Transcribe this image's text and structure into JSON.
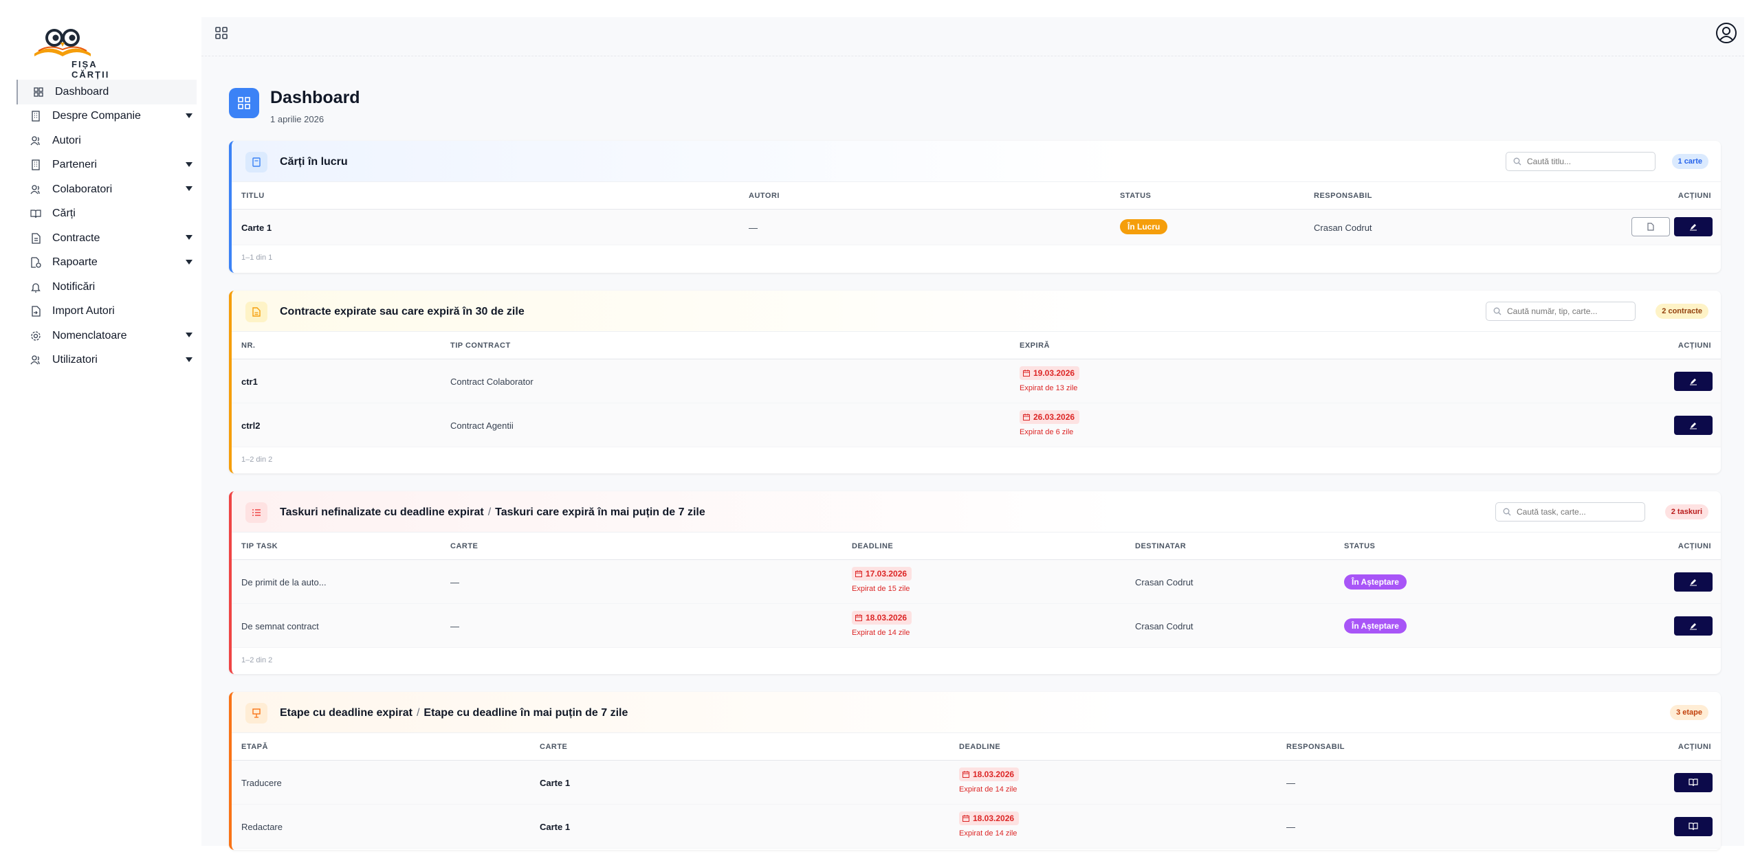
{
  "brand": {
    "logo_text": "FIȘA CĂRȚII"
  },
  "sidebar": {
    "items": [
      {
        "label": "Dashboard",
        "icon": "grid-icon",
        "active": true,
        "has_submenu": false
      },
      {
        "label": "Despre Companie",
        "icon": "building-icon",
        "has_submenu": true
      },
      {
        "label": "Autori",
        "icon": "users-icon",
        "has_submenu": false
      },
      {
        "label": "Parteneri",
        "icon": "building-icon",
        "has_submenu": true
      },
      {
        "label": "Colaboratori",
        "icon": "users-icon",
        "has_submenu": true
      },
      {
        "label": "Cărți",
        "icon": "book-icon",
        "has_submenu": false
      },
      {
        "label": "Contracte",
        "icon": "document-icon",
        "has_submenu": true
      },
      {
        "label": "Rapoarte",
        "icon": "report-icon",
        "has_submenu": true
      },
      {
        "label": "Notificări",
        "icon": "bell-icon",
        "has_submenu": false
      },
      {
        "label": "Import Autori",
        "icon": "file-import-icon",
        "has_submenu": false
      },
      {
        "label": "Nomenclatoare",
        "icon": "settings-icon",
        "has_submenu": true
      },
      {
        "label": "Utilizatori",
        "icon": "users-icon",
        "has_submenu": true
      }
    ]
  },
  "header": {
    "title": "Dashboard",
    "date": "1 aprilie 2026"
  },
  "books_card": {
    "title": "Cărți în lucru",
    "search_placeholder": "Caută titlu...",
    "count": "1 carte",
    "columns": [
      "TITLU",
      "AUTORI",
      "STATUS",
      "RESPONSABIL",
      "ACȚIUNI"
    ],
    "rows": [
      {
        "title": "Carte 1",
        "authors": "—",
        "status": "În Lucru",
        "responsible": "Crasan Codrut"
      }
    ],
    "footer": "1–1 din 1"
  },
  "contracts_card": {
    "title": "Contracte expirate sau care expiră în 30 de zile",
    "search_placeholder": "Caută număr, tip, carte...",
    "count": "2 contracte",
    "columns": [
      "NR.",
      "TIP CONTRACT",
      "EXPIRĂ",
      "ACȚIUNI"
    ],
    "rows": [
      {
        "nr": "ctr1",
        "type": "Contract Colaborator",
        "date": "19.03.2026",
        "expired": "Expirat de 13 zile"
      },
      {
        "nr": "ctrl2",
        "type": "Contract Agentii",
        "date": "26.03.2026",
        "expired": "Expirat de 6 zile"
      }
    ],
    "footer": "1–2 din 2"
  },
  "tasks_card": {
    "title_a": "Taskuri nefinalizate cu deadline expirat",
    "separator": "/",
    "title_b": "Taskuri care expiră în mai puțin de 7 zile",
    "search_placeholder": "Caută task, carte...",
    "count": "2 taskuri",
    "columns": [
      "TIP TASK",
      "CARTE",
      "DEADLINE",
      "DESTINATAR",
      "STATUS",
      "ACȚIUNI"
    ],
    "rows": [
      {
        "type": "De primit de la auto...",
        "book": "—",
        "date": "17.03.2026",
        "expired": "Expirat de 15 zile",
        "recipient": "Crasan Codrut",
        "status": "În Așteptare"
      },
      {
        "type": "De semnat contract",
        "book": "—",
        "date": "18.03.2026",
        "expired": "Expirat de 14 zile",
        "recipient": "Crasan Codrut",
        "status": "În Așteptare"
      }
    ],
    "footer": "1–2 din 2"
  },
  "stages_card": {
    "title_a": "Etape cu deadline expirat",
    "separator": "/",
    "title_b": "Etape cu deadline în mai puțin de 7 zile",
    "count": "3 etape",
    "columns": [
      "ETAPĂ",
      "CARTE",
      "DEADLINE",
      "RESPONSABIL",
      "ACȚIUNI"
    ],
    "rows": [
      {
        "stage": "Traducere",
        "book": "Carte 1",
        "date": "18.03.2026",
        "expired": "Expirat de 14 zile",
        "responsible": "—"
      },
      {
        "stage": "Redactare",
        "book": "Carte 1",
        "date": "18.03.2026",
        "expired": "Expirat de 14 zile",
        "responsible": "—"
      }
    ]
  },
  "colors": {
    "blue_accent": "#3b82f6",
    "yellow_accent": "#f59e0b",
    "red_accent": "#ef4444",
    "orange_accent": "#f97316",
    "action_button": "#0c0a4a",
    "status_in_lucru": "#f59e0b",
    "status_asteptare": "#a855f7"
  }
}
